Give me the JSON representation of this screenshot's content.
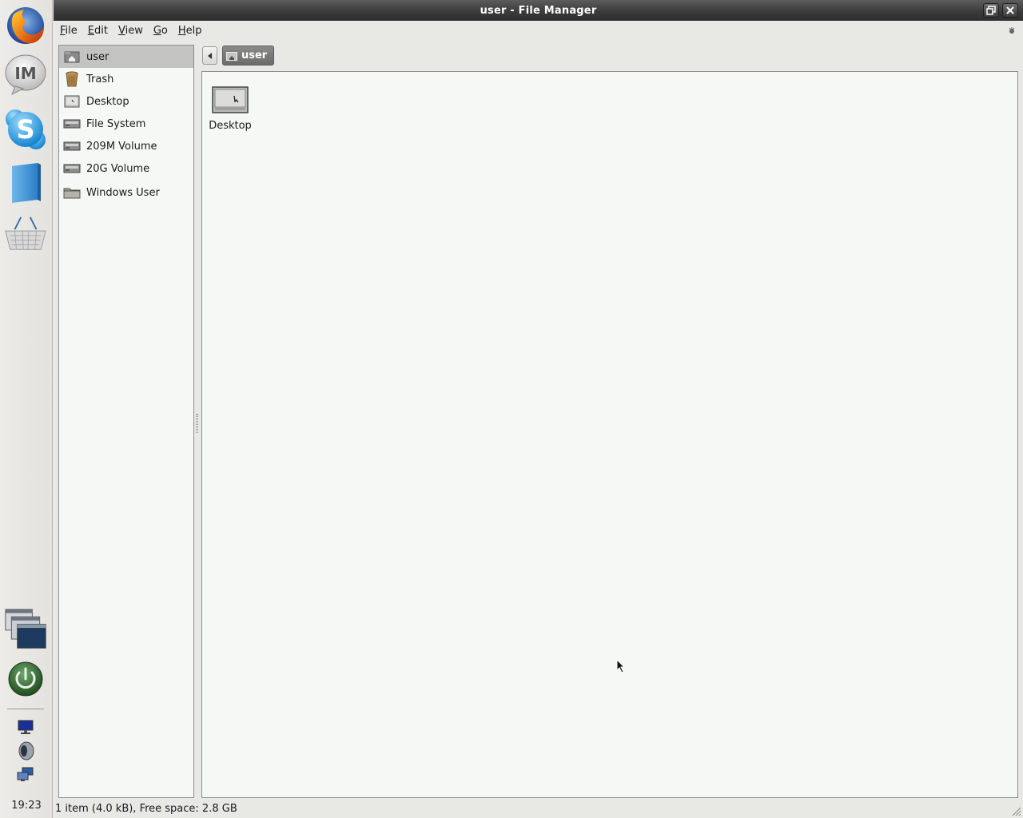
{
  "window": {
    "title": "user - File Manager"
  },
  "menubar": {
    "items": [
      {
        "mnemonic": "F",
        "rest": "ile"
      },
      {
        "mnemonic": "E",
        "rest": "dit"
      },
      {
        "mnemonic": "V",
        "rest": "iew"
      },
      {
        "mnemonic": "G",
        "rest": "o"
      },
      {
        "mnemonic": "H",
        "rest": "elp"
      }
    ]
  },
  "sidebar": {
    "items": [
      {
        "label": "user",
        "icon": "home-folder-icon",
        "selected": true
      },
      {
        "label": "Trash",
        "icon": "trash-icon"
      },
      {
        "label": "Desktop",
        "icon": "desktop-icon"
      },
      {
        "label": "File System",
        "icon": "drive-icon"
      },
      {
        "label": "209M Volume",
        "icon": "drive-icon"
      },
      {
        "label": "20G Volume",
        "icon": "drive-icon"
      },
      {
        "label": "Windows User",
        "icon": "folder-icon"
      }
    ]
  },
  "pathbar": {
    "current": "user"
  },
  "files": [
    {
      "name": "Desktop",
      "icon": "desktop-icon"
    }
  ],
  "status": {
    "text": "1 item (4.0 kB), Free space: 2.8 GB"
  },
  "taskbar": {
    "clock": "19:23",
    "launchers": [
      "firefox-icon",
      "im-icon",
      "skype-icon",
      "files-icon",
      "shop-basket-icon"
    ],
    "tray": [
      "display-icon",
      "volume-icon",
      "network-icon"
    ]
  },
  "colors": {
    "titlebar": "#3b3b3b",
    "selection": "#c3c3c1",
    "view_background": "#f5f8f5"
  }
}
